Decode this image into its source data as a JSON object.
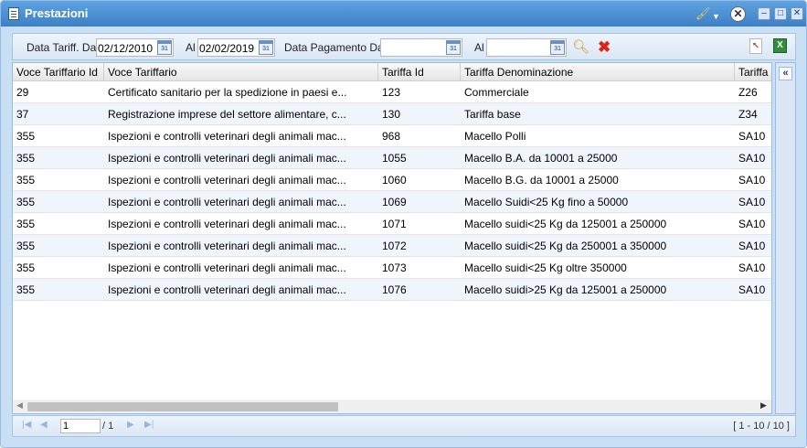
{
  "window": {
    "title": "Prestazioni"
  },
  "filters": {
    "data_tariff_dal_label": "Data Tariff. Dal",
    "data_tariff_dal_value": "02/12/2010",
    "al1_label": "Al",
    "al1_value": "02/02/2019",
    "data_pagamento_dal_label": "Data Pagamento Dal",
    "data_pagamento_dal_value": "",
    "al2_label": "Al",
    "al2_value": ""
  },
  "grid": {
    "columns": [
      "Voce Tariffario Id",
      "Voce Tariffario",
      "Tariffa Id",
      "Tariffa Denominazione",
      "Tariffa"
    ],
    "rows": [
      [
        "29",
        "Certificato sanitario per la spedizione in paesi e...",
        "123",
        "Commerciale",
        "Z26"
      ],
      [
        "37",
        "Registrazione imprese del settore alimentare, c...",
        "130",
        "Tariffa base",
        "Z34"
      ],
      [
        "355",
        "Ispezioni e controlli veterinari degli animali mac...",
        "968",
        "Macello Polli",
        "SA10"
      ],
      [
        "355",
        "Ispezioni e controlli veterinari degli animali mac...",
        "1055",
        "Macello B.A. da 10001 a 25000",
        "SA10"
      ],
      [
        "355",
        "Ispezioni e controlli veterinari degli animali mac...",
        "1060",
        "Macello B.G. da 10001 a 25000",
        "SA10"
      ],
      [
        "355",
        "Ispezioni e controlli veterinari degli animali mac...",
        "1069",
        "Macello Suidi<25 Kg fino a 50000",
        "SA10"
      ],
      [
        "355",
        "Ispezioni e controlli veterinari degli animali mac...",
        "1071",
        "Macello suidi<25 Kg da 125001 a 250000",
        "SA10"
      ],
      [
        "355",
        "Ispezioni e controlli veterinari degli animali mac...",
        "1072",
        "Macello suidi<25 Kg da 250001 a 350000",
        "SA10"
      ],
      [
        "355",
        "Ispezioni e controlli veterinari degli animali mac...",
        "1073",
        "Macello suidi<25 Kg oltre 350000",
        "SA10"
      ],
      [
        "355",
        "Ispezioni e controlli veterinari degli animali mac...",
        "1076",
        "Macello suidi>25 Kg da 125001 a 250000",
        "SA10"
      ]
    ]
  },
  "pager": {
    "page_value": "1",
    "of_text": "/ 1",
    "info": "[ 1 - 10 / 10 ]"
  },
  "icons": {
    "search": "search-icon",
    "clear": "clear-filter-icon",
    "pdf": "pdf-export-icon",
    "excel": "excel-export-icon"
  },
  "colors": {
    "accent": "#3d7fc6",
    "panel": "#c9dff4",
    "alt_row": "#f0f5fc"
  }
}
